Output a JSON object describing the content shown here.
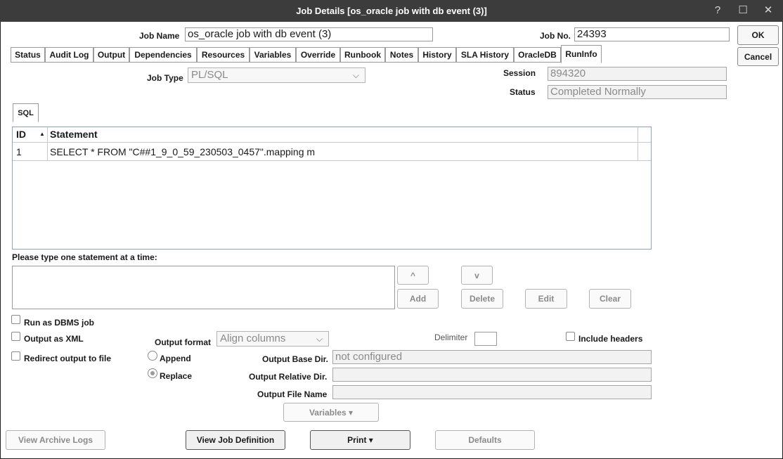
{
  "window": {
    "title": "Job Details [os_oracle job with db event (3)]",
    "help_icon": "?",
    "maximize_icon": "☐",
    "close_icon": "✕"
  },
  "header": {
    "job_name_label": "Job Name",
    "job_name_value": "os_oracle job with db event (3)",
    "job_no_label": "Job No.",
    "job_no_value": "24393",
    "ok_label": "OK",
    "cancel_label": "Cancel"
  },
  "tabs": [
    {
      "label": "Status"
    },
    {
      "label": "Audit Log"
    },
    {
      "label": "Output"
    },
    {
      "label": "Dependencies"
    },
    {
      "label": "Resources"
    },
    {
      "label": "Variables"
    },
    {
      "label": "Override"
    },
    {
      "label": "Runbook"
    },
    {
      "label": "Notes"
    },
    {
      "label": "History"
    },
    {
      "label": "SLA History"
    },
    {
      "label": "OracleDB"
    },
    {
      "label": "RunInfo"
    }
  ],
  "runinfo": {
    "job_type_label": "Job Type",
    "job_type_value": "PL/SQL",
    "session_label": "Session",
    "session_value": "894320",
    "status_label": "Status",
    "status_value": "Completed Normally",
    "sql_tab_label": "SQL",
    "grid": {
      "columns": [
        "ID",
        "Statement"
      ],
      "sort_icon": "▲",
      "rows": [
        {
          "id": "1",
          "statement": "SELECT * FROM \"C##1_9_0_59_230503_0457\".mapping m"
        }
      ]
    },
    "prompt_label": "Please type one statement at a time:",
    "statement_input_value": "",
    "up_button": "^",
    "down_button": "v",
    "add_button": "Add",
    "delete_button": "Delete",
    "edit_button": "Edit",
    "clear_button": "Clear"
  },
  "options": {
    "run_as_dbms_label": "Run as DBMS job",
    "output_as_xml_label": "Output as XML",
    "redirect_label": "Redirect output to file",
    "output_format_label": "Output format",
    "output_format_value": "Align columns",
    "delimiter_label": "Delimiter",
    "include_headers_label": "Include headers",
    "append_label": "Append",
    "replace_label": "Replace",
    "base_dir_label": "Output Base Dir.",
    "base_dir_value": "not configured",
    "relative_dir_label": "Output Relative Dir.",
    "relative_dir_value": "",
    "file_name_label": "Output File Name",
    "file_name_value": "",
    "variables_button": "Variables ▾"
  },
  "footer": {
    "view_archive_logs": "View Archive Logs",
    "view_job_definition": "View Job Definition",
    "print": "Print ▾",
    "defaults": "Defaults"
  }
}
